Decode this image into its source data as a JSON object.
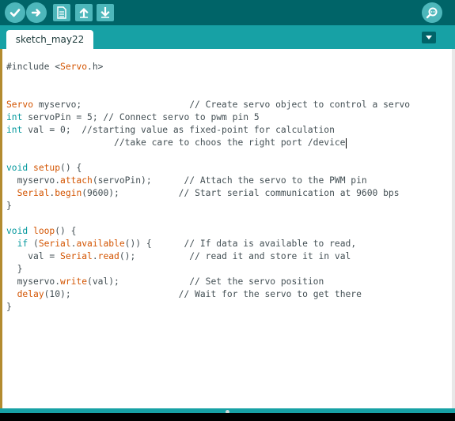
{
  "toolbar": {
    "buttons": [
      {
        "icon": "checkmark-icon",
        "name": "verify-button"
      },
      {
        "icon": "arrow-right-icon",
        "name": "upload-button"
      },
      {
        "icon": "new-file-icon",
        "name": "new-button"
      },
      {
        "icon": "arrow-up-icon",
        "name": "open-button"
      },
      {
        "icon": "arrow-down-icon",
        "name": "save-button"
      }
    ],
    "serial_monitor_icon": "magnifier-icon"
  },
  "tabs": [
    {
      "label": "sketch_may22"
    }
  ],
  "tab_menu_icon": "triangle-down-icon",
  "colors": {
    "toolbar": "#006468",
    "tabbar": "#17a1a5",
    "keyword": "#00979c",
    "function": "#d35400",
    "text": "#434f54"
  },
  "code": {
    "lines": [
      [
        {
          "t": "#include <",
          "c": "plain"
        },
        {
          "t": "Servo",
          "c": "fn"
        },
        {
          "t": ".h>",
          "c": "plain"
        }
      ],
      [],
      [],
      [
        {
          "t": "Servo",
          "c": "fn"
        },
        {
          "t": " myservo;                    // Create servo object to control a servo",
          "c": "plain"
        }
      ],
      [
        {
          "t": "int",
          "c": "kw"
        },
        {
          "t": " servoPin = 5; // Connect servo to pwm pin 5",
          "c": "plain"
        }
      ],
      [
        {
          "t": "int",
          "c": "kw"
        },
        {
          "t": " val = 0;  //starting value as fixed-point for calculation",
          "c": "plain"
        }
      ],
      [
        {
          "t": "                    //take care to choos the right port /device",
          "c": "plain"
        }
      ],
      [],
      [
        {
          "t": "void",
          "c": "kw"
        },
        {
          "t": " ",
          "c": "plain"
        },
        {
          "t": "setup",
          "c": "fn"
        },
        {
          "t": "() {",
          "c": "plain"
        }
      ],
      [
        {
          "t": "  myservo.",
          "c": "plain"
        },
        {
          "t": "attach",
          "c": "fn"
        },
        {
          "t": "(servoPin);      // Attach the servo to the PWM pin",
          "c": "plain"
        }
      ],
      [
        {
          "t": "  ",
          "c": "plain"
        },
        {
          "t": "Serial",
          "c": "fn"
        },
        {
          "t": ".",
          "c": "plain"
        },
        {
          "t": "begin",
          "c": "fn"
        },
        {
          "t": "(9600);           // Start serial communication at 9600 bps",
          "c": "plain"
        }
      ],
      [
        {
          "t": "}",
          "c": "plain"
        }
      ],
      [],
      [
        {
          "t": "void",
          "c": "kw"
        },
        {
          "t": " ",
          "c": "plain"
        },
        {
          "t": "loop",
          "c": "fn"
        },
        {
          "t": "() {",
          "c": "plain"
        }
      ],
      [
        {
          "t": "  ",
          "c": "plain"
        },
        {
          "t": "if",
          "c": "kw"
        },
        {
          "t": " (",
          "c": "plain"
        },
        {
          "t": "Serial",
          "c": "fn"
        },
        {
          "t": ".",
          "c": "plain"
        },
        {
          "t": "available",
          "c": "fn"
        },
        {
          "t": "()) {      // If data is available to read,",
          "c": "plain"
        }
      ],
      [
        {
          "t": "    val = ",
          "c": "plain"
        },
        {
          "t": "Serial",
          "c": "fn"
        },
        {
          "t": ".",
          "c": "plain"
        },
        {
          "t": "read",
          "c": "fn"
        },
        {
          "t": "();          // read it and store it in val",
          "c": "plain"
        }
      ],
      [
        {
          "t": "  }",
          "c": "plain"
        }
      ],
      [
        {
          "t": "  myservo.",
          "c": "plain"
        },
        {
          "t": "write",
          "c": "fn"
        },
        {
          "t": "(val);             // Set the servo position",
          "c": "plain"
        }
      ],
      [
        {
          "t": "  ",
          "c": "plain"
        },
        {
          "t": "delay",
          "c": "fn"
        },
        {
          "t": "(10);                    // Wait for the servo to get there",
          "c": "plain"
        }
      ],
      [
        {
          "t": "}",
          "c": "plain"
        }
      ]
    ],
    "cursor_line": 6
  }
}
